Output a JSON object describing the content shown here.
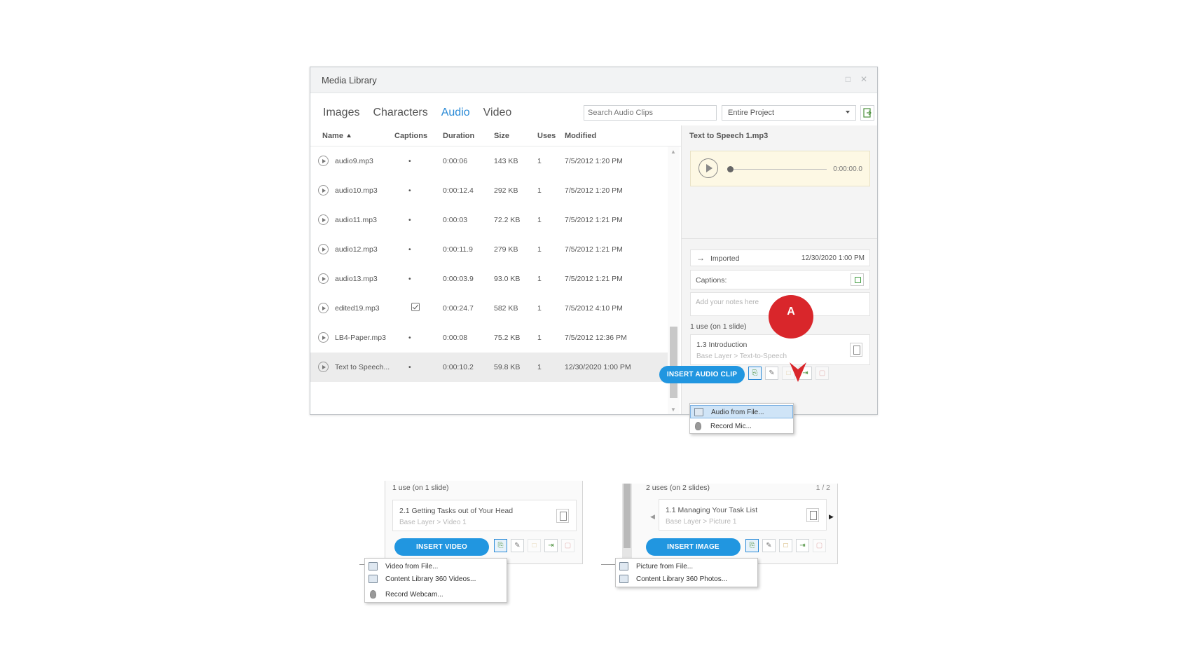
{
  "window": {
    "title": "Media Library",
    "tabs": [
      {
        "label": "Images"
      },
      {
        "label": "Characters"
      },
      {
        "label": "Audio"
      },
      {
        "label": "Video"
      }
    ],
    "active_tab": "Audio",
    "search_placeholder": "Search Audio Clips",
    "scope_selected": "Entire Project",
    "accent_color": "#2a8ad6"
  },
  "table": {
    "columns": [
      "Name",
      "Captions",
      "Duration",
      "Size",
      "Uses",
      "Modified"
    ],
    "sort_column": "Name",
    "sort_direction": "ascending",
    "rows": [
      {
        "name": "audio9.mp3",
        "captions": "•",
        "duration": "0:00:06",
        "size": "143 KB",
        "uses": "1",
        "modified": "7/5/2012 1:20 PM"
      },
      {
        "name": "audio10.mp3",
        "captions": "•",
        "duration": "0:00:12.4",
        "size": "292 KB",
        "uses": "1",
        "modified": "7/5/2012 1:20 PM"
      },
      {
        "name": "audio11.mp3",
        "captions": "•",
        "duration": "0:00:03",
        "size": "72.2 KB",
        "uses": "1",
        "modified": "7/5/2012 1:21 PM"
      },
      {
        "name": "audio12.mp3",
        "captions": "•",
        "duration": "0:00:11.9",
        "size": "279 KB",
        "uses": "1",
        "modified": "7/5/2012 1:21 PM"
      },
      {
        "name": "audio13.mp3",
        "captions": "•",
        "duration": "0:00:03.9",
        "size": "93.0 KB",
        "uses": "1",
        "modified": "7/5/2012 1:21 PM"
      },
      {
        "name": "edited19.mp3",
        "captions": "",
        "has_caption_check": true,
        "duration": "0:00:24.7",
        "size": "582 KB",
        "uses": "1",
        "modified": "7/5/2012 4:10 PM"
      },
      {
        "name": "LB4-Paper.mp3",
        "captions": "•",
        "duration": "0:00:08",
        "size": "75.2 KB",
        "uses": "1",
        "modified": "7/5/2012 12:36 PM"
      },
      {
        "name": "Text to Speech...",
        "captions": "•",
        "duration": "0:00:10.2",
        "size": "59.8 KB",
        "uses": "1",
        "modified": "12/30/2020 1:00 PM",
        "selected": true
      }
    ]
  },
  "details": {
    "title": "Text to Speech 1.mp3",
    "player_time": "0:00:00.0",
    "imported_label": "Imported",
    "imported_date": "12/30/2020 1:00 PM",
    "captions_label": "Captions:",
    "notes_placeholder": "Add your notes here",
    "uses_summary": "1 use (on 1 slide)",
    "use_slide": "1.3 Introduction",
    "use_path": "Base Layer > Text-to-Speech",
    "insert_label": "INSERT AUDIO CLIP",
    "menu": [
      "Audio from File...",
      "Record Mic..."
    ],
    "menu_highlighted": "Audio from File..."
  },
  "callout": {
    "label": "A",
    "color": "#d9262b"
  },
  "video_panel": {
    "uses_summary": "1 use (on 1 slide)",
    "use_slide": "2.1 Getting Tasks out of Your Head",
    "use_path": "Base Layer > Video 1",
    "insert_label": "INSERT VIDEO",
    "menu": [
      "Video from File...",
      "Content Library 360 Videos...",
      "Record Webcam..."
    ]
  },
  "image_panel": {
    "uses_summary": "2 uses (on 2 slides)",
    "pager": "1 / 2",
    "use_slide": "1.1 Managing Your Task List",
    "use_path": "Base Layer > Picture 1",
    "insert_label": "INSERT IMAGE",
    "menu": [
      "Picture from File...",
      "Content Library 360 Photos..."
    ]
  }
}
